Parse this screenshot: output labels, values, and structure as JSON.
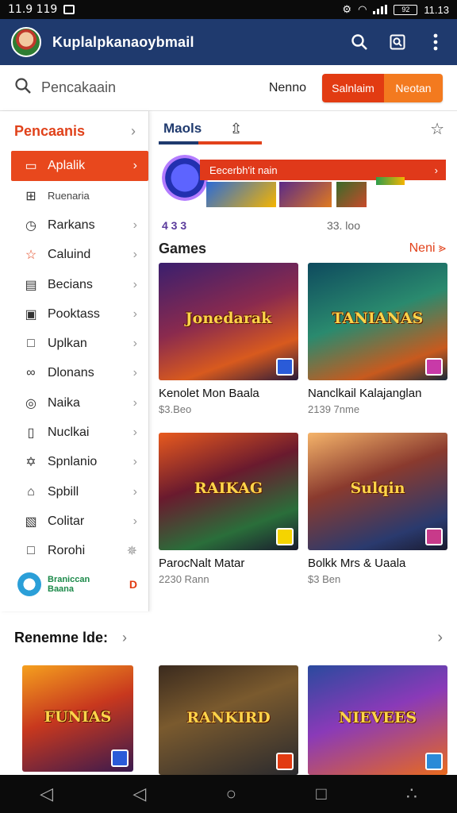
{
  "status_bar": {
    "time": "11.9 119",
    "battery": "92",
    "signal_text": "11.13"
  },
  "app_bar": {
    "title": "Kuplalpkanaoybmail",
    "icons": [
      "search-icon",
      "screenshot-icon",
      "more-vert-icon"
    ]
  },
  "search": {
    "placeholder": "Pencakaain",
    "nav_link": "Nenno",
    "seg_a": "Salnlaim",
    "seg_b": "Neotan"
  },
  "sidebar": {
    "header": "Pencaanis",
    "items": [
      {
        "label": "Aplalik",
        "icon": "doc-icon",
        "active": true
      },
      {
        "label": "Ruenaria",
        "icon": "grid-icon",
        "small": true
      },
      {
        "label": "Rarkans",
        "icon": "clock-icon"
      },
      {
        "label": "Caluind",
        "icon": "star-icon"
      },
      {
        "label": "Becians",
        "icon": "calendar-icon"
      },
      {
        "label": "Pooktass",
        "icon": "box-icon"
      },
      {
        "label": "Uplkan",
        "icon": "square-icon"
      },
      {
        "label": "Dlonans",
        "icon": "link-icon"
      },
      {
        "label": "Naika",
        "icon": "chat-icon"
      },
      {
        "label": "Nuclkai",
        "icon": "bookmark-icon"
      },
      {
        "label": "Spnlanio",
        "icon": "badge-icon"
      },
      {
        "label": "Spbill",
        "icon": "home-icon"
      },
      {
        "label": "Colitar",
        "icon": "note-icon"
      },
      {
        "label": "Rorohi",
        "icon": "square-icon",
        "trail": "✵"
      }
    ],
    "footer": {
      "line1": "Braniccan",
      "line2": "Baana",
      "badge": "D"
    }
  },
  "tabs": {
    "tab1": "Maols",
    "tab2_icon": "⇫"
  },
  "banner": {
    "bar_text": "Eecerbh'it nain",
    "sub_left": "4 3 3",
    "sub_right": "33. loo"
  },
  "games": {
    "title": "Games",
    "more": "Neni ⪢",
    "cards": [
      {
        "art_title": "Jonedarak",
        "name": "Kenolet Mon Baala",
        "meta": "$3.Beo"
      },
      {
        "art_title": "TANIANAS",
        "name": "Nanclkail Kalajanglan",
        "meta": "2139 7nme"
      },
      {
        "art_title": "RAIKAG",
        "name": "ParocNalt Matar",
        "meta": "2230 Rann"
      },
      {
        "art_title": "Sulqin",
        "name": "Bolkk Mrs & Uaala",
        "meta": "$3 Ben"
      }
    ]
  },
  "recommended": {
    "title": "Renemne lde:",
    "cards": [
      {
        "art_title": "FUNIAS"
      },
      {
        "art_title": "RANKIRD"
      },
      {
        "art_title": "NIEVEES"
      }
    ]
  },
  "nav_bar": {
    "icons": [
      "back-icon",
      "back-icon",
      "home-circle-icon",
      "recents-icon",
      "assistant-icon"
    ]
  }
}
